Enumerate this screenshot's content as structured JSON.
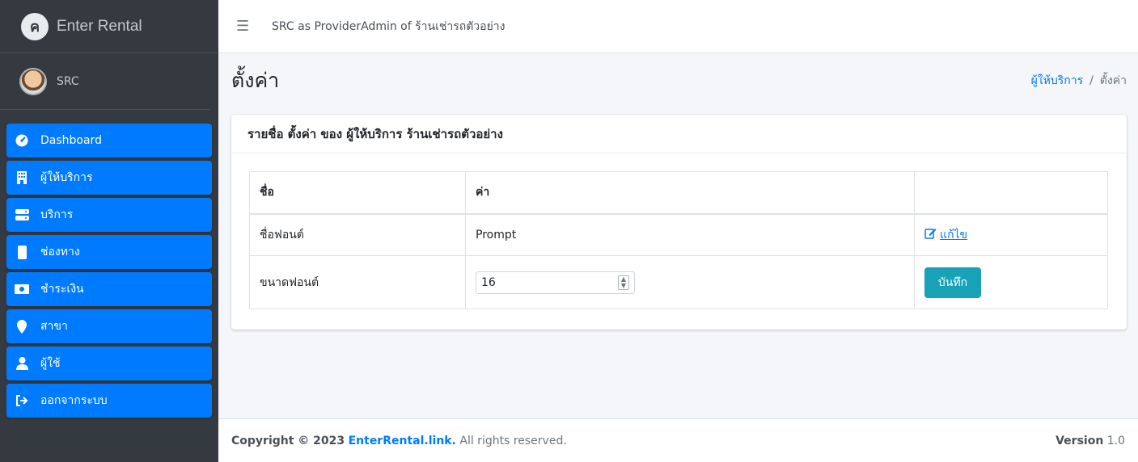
{
  "brand": {
    "logo_letter": "ค",
    "name": "Enter Rental"
  },
  "user": {
    "name": "SRC"
  },
  "nav": [
    {
      "label": "Dashboard",
      "icon": "dashboard-icon"
    },
    {
      "label": "ผู้ให้บริการ",
      "icon": "building-icon"
    },
    {
      "label": "บริการ",
      "icon": "server-icon"
    },
    {
      "label": "ช่องทาง",
      "icon": "mobile-icon"
    },
    {
      "label": "ชำระเงิน",
      "icon": "money-icon"
    },
    {
      "label": "สาขา",
      "icon": "map-marker-icon"
    },
    {
      "label": "ผู้ใช้",
      "icon": "user-icon"
    },
    {
      "label": "ออกจากระบบ",
      "icon": "logout-icon"
    }
  ],
  "header": {
    "title": "SRC as ProviderAdmin of ร้านเช่ารถตัวอย่าง"
  },
  "page": {
    "title": "ตั้งค่า",
    "breadcrumb": {
      "parent": "ผู้ให้บริการ",
      "current": "ตั้งค่า"
    }
  },
  "card": {
    "title": "รายชื่อ ตั้งค่า ของ ผู้ให้บริการ ร้านเช่ารถตัวอย่าง",
    "columns": [
      "ชื่อ",
      "ค่า",
      ""
    ],
    "rows": [
      {
        "name": "ชื่อฟอนต์",
        "value": "Prompt",
        "action": "แก้ไข"
      },
      {
        "name": "ขนาดฟอนต์",
        "input_value": "16",
        "action": "บันทึก"
      }
    ]
  },
  "footer": {
    "copyright_prefix": "Copyright © 2023",
    "site": "EnterRental.link.",
    "suffix": "All rights reserved.",
    "version_label": "Version",
    "version_value": "1.0"
  }
}
